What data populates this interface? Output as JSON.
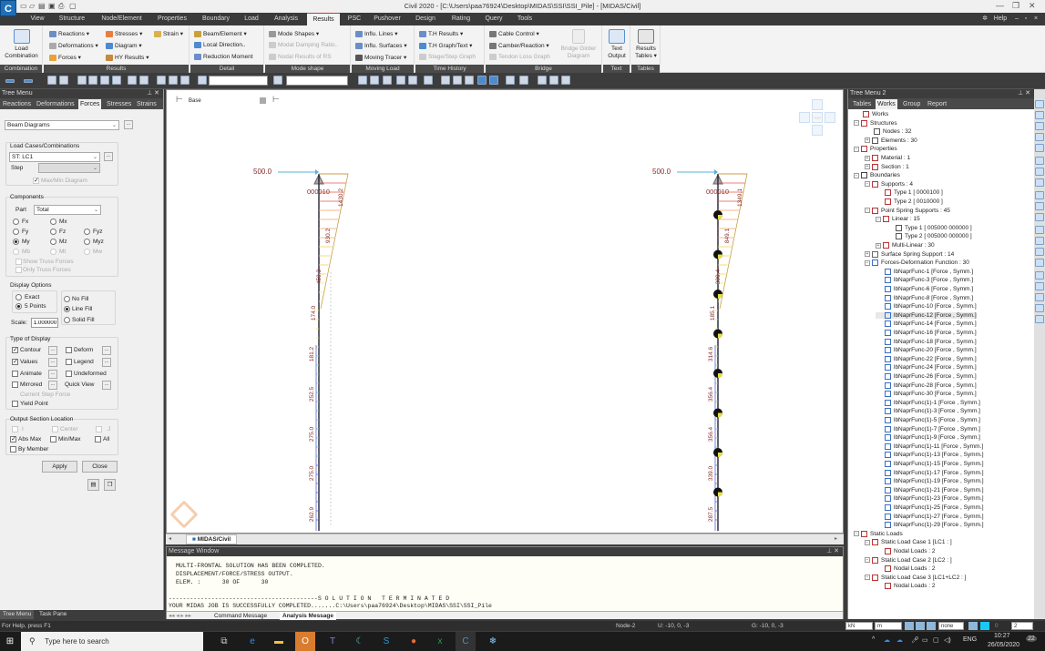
{
  "window": {
    "title": "Civil 2020 - [C:\\Users\\paa76924\\Desktop\\MIDAS\\SSI\\SSI_Pile] - [MIDAS/Civil]",
    "app_icon_letter": "C",
    "help_label": "Help"
  },
  "menu": {
    "tabs": [
      "View",
      "Structure",
      "Node/Element",
      "Properties",
      "Boundary",
      "Load",
      "Analysis",
      "Results",
      "PSC",
      "Pushover",
      "Design",
      "Rating",
      "Query",
      "Tools"
    ],
    "active": "Results"
  },
  "ribbon": {
    "groups": [
      {
        "label": "Combination",
        "items": [
          "Load Combination"
        ]
      },
      {
        "label": "Results",
        "items": [
          "Reactions",
          "Deformations",
          "Forces",
          "Stresses",
          "Diagram",
          "HY Results",
          "Strain"
        ]
      },
      {
        "label": "Detail",
        "items": [
          "Beam/Element",
          "Local Direction..",
          "Reduction Moment"
        ]
      },
      {
        "label": "Mode shape",
        "items": [
          "Mode Shapes",
          "Modal Damping Ratio..",
          "Nodal Results of RS"
        ]
      },
      {
        "label": "Moving Load",
        "items": [
          "Influ. Lines",
          "Influ. Surfaces",
          "Moving Tracer"
        ]
      },
      {
        "label": "Time History",
        "items": [
          "T.H Results",
          "T.H Graph/Text",
          "Stage/Step Graph"
        ]
      },
      {
        "label": "Bridge",
        "items": [
          "Cable Control",
          "Camber/Reaction",
          "Tendon Loss Graph",
          "Bridge Girder Diagram"
        ]
      },
      {
        "label": "Text",
        "items": [
          "Text Output"
        ]
      },
      {
        "label": "Tables",
        "items": [
          "Results Tables"
        ]
      }
    ]
  },
  "tree_menu": {
    "title": "Tree Menu",
    "tabs": [
      "Reactions",
      "Deformations",
      "Forces",
      "Stresses",
      "Strains"
    ],
    "active_tab": "Forces",
    "diagram_type": "Beam Diagrams",
    "load_cases_label": "Load Cases/Combinations",
    "load_case": "ST: LC1",
    "step_label": "Step",
    "step_value": "",
    "maxmin_label": "Max/Min Diagram",
    "components_label": "Components",
    "part_label": "Part",
    "part_value": "Total",
    "components": [
      "Fx",
      "Mx",
      "Fy",
      "Fz",
      "Fyz",
      "My",
      "Mz",
      "Myz",
      "Mb",
      "Mt",
      "Mw"
    ],
    "selected_component": "My",
    "show_truss": "Show Truss Forces",
    "only_truss": "Only Truss Forces",
    "display_options_label": "Display Options",
    "exact_label": "Exact",
    "five_points_label": "5 Points",
    "no_fill_label": "No Fill",
    "line_fill_label": "Line Fill",
    "solid_fill_label": "Solid Fill",
    "scale_label": "Scale:",
    "scale_value": "1.000000",
    "type_of_display_label": "Type of Display",
    "contour_label": "Contour",
    "deform_label": "Deform",
    "values_label": "Values",
    "legend_label": "Legend",
    "animate_label": "Animate",
    "undeformed_label": "Undeformed",
    "mirrored_label": "Mirrored",
    "quick_view_label": "Quick View",
    "current_step_force_label": "Current Step Force",
    "yield_point_label": "Yield Point",
    "output_section_label": "Output Section Location",
    "i_label": "I",
    "center_label": "Center",
    "j_label": "J",
    "abs_max_label": "Abs Max",
    "min_max_label": "Min/Max",
    "all_label": "All",
    "by_member_label": "By Member",
    "apply_label": "Apply",
    "close_label": "Close",
    "bottom_tabs": [
      "Tree Menu",
      "Task Pane"
    ]
  },
  "viewport": {
    "view_label": "Base",
    "tab_label": "MIDAS/Civil",
    "left_model": {
      "load_label": "500.0",
      "support_label": "000010",
      "values": [
        "1430.2",
        "930.2",
        "459.3",
        "174.0",
        "181.2",
        "252.5",
        "275.0",
        "275.0",
        "262.9"
      ]
    },
    "right_model": {
      "load_label": "500.0",
      "support_label": "000010",
      "values": [
        "1349.1",
        "849.1",
        "399.4",
        "185.1",
        "314.6",
        "356.4",
        "356.4",
        "339.0",
        "287.5"
      ]
    }
  },
  "message_window": {
    "title": "Message Window",
    "lines": [
      "MULTI-FRONTAL SOLUTION HAS BEEN COMPLETED.",
      "DISPLACEMENT/FORCE/STRESS OUTPUT.",
      "ELEM. :      30 OF      30",
      "",
      "------------------------------------------S O L U T I O N   T E R M I N A T E D",
      "YOUR MIDAS JOB IS SUCCESSFULLY COMPLETED.......C:\\Users\\paa76924\\Desktop\\MIDAS\\SSI\\SSI_Pile"
    ],
    "tabs": [
      "Command Message",
      "Analysis Message"
    ],
    "active_tab": "Analysis Message"
  },
  "tree_menu2": {
    "title": "Tree Menu 2",
    "tabs": [
      "Tables",
      "Works",
      "Group",
      "Report"
    ],
    "active_tab": "Works",
    "items": [
      {
        "level": 0,
        "text": "Works",
        "exp": ""
      },
      {
        "level": 0,
        "text": "Structures",
        "exp": "-"
      },
      {
        "level": 1,
        "text": "Nodes : 32",
        "exp": ""
      },
      {
        "level": 1,
        "text": "Elements : 30",
        "exp": "+"
      },
      {
        "level": 0,
        "text": "Properties",
        "exp": "-"
      },
      {
        "level": 1,
        "text": "Material : 1",
        "exp": "+"
      },
      {
        "level": 1,
        "text": "Section : 1",
        "exp": "+"
      },
      {
        "level": 0,
        "text": "Boundaries",
        "exp": "-"
      },
      {
        "level": 1,
        "text": "Supports : 4",
        "exp": "-"
      },
      {
        "level": 2,
        "text": "Type 1 [ 0000100 ]",
        "exp": ""
      },
      {
        "level": 2,
        "text": "Type 2 [ 0010000 ]",
        "exp": ""
      },
      {
        "level": 1,
        "text": "Point Spring Supports : 45",
        "exp": "-"
      },
      {
        "level": 2,
        "text": "Linear : 15",
        "exp": "-"
      },
      {
        "level": 3,
        "text": "Type 1 [ 005000 000000 ]",
        "exp": ""
      },
      {
        "level": 3,
        "text": "Type 2 [ 005000 000000 ]",
        "exp": ""
      },
      {
        "level": 2,
        "text": "Multi-Linear : 30",
        "exp": "+"
      },
      {
        "level": 1,
        "text": "Surface Spring Support : 14",
        "exp": "+"
      },
      {
        "level": 1,
        "text": "Forces-Deformation Function : 30",
        "exp": "-"
      },
      {
        "level": 2,
        "text": "lbNaprFunc-1 [Force , Symm.]",
        "exp": ""
      },
      {
        "level": 2,
        "text": "lbNaprFunc-3 [Force , Symm.]",
        "exp": ""
      },
      {
        "level": 2,
        "text": "lbNaprFunc-6 [Force , Symm.]",
        "exp": ""
      },
      {
        "level": 2,
        "text": "lbNaprFunc-8 [Force , Symm.]",
        "exp": ""
      },
      {
        "level": 2,
        "text": "lbNaprFunc-10 [Force , Symm.]",
        "exp": ""
      },
      {
        "level": 2,
        "text": "lbNaprFunc-12 [Force , Symm.]",
        "exp": "",
        "selected": true
      },
      {
        "level": 2,
        "text": "lbNaprFunc-14 [Force , Symm.]",
        "exp": ""
      },
      {
        "level": 2,
        "text": "lbNaprFunc-16 [Force , Symm.]",
        "exp": ""
      },
      {
        "level": 2,
        "text": "lbNaprFunc-18 [Force , Symm.]",
        "exp": ""
      },
      {
        "level": 2,
        "text": "lbNaprFunc-20 [Force , Symm.]",
        "exp": ""
      },
      {
        "level": 2,
        "text": "lbNaprFunc-22 [Force , Symm.]",
        "exp": ""
      },
      {
        "level": 2,
        "text": "lbNaprFunc-24 [Force , Symm.]",
        "exp": ""
      },
      {
        "level": 2,
        "text": "lbNaprFunc-26 [Force , Symm.]",
        "exp": ""
      },
      {
        "level": 2,
        "text": "lbNaprFunc-28 [Force , Symm.]",
        "exp": ""
      },
      {
        "level": 2,
        "text": "lbNaprFunc-30 [Force , Symm.]",
        "exp": ""
      },
      {
        "level": 2,
        "text": "lbNaprFunc(1)-1 [Force , Symm.]",
        "exp": ""
      },
      {
        "level": 2,
        "text": "lbNaprFunc(1)-3 [Force , Symm.]",
        "exp": ""
      },
      {
        "level": 2,
        "text": "lbNaprFunc(1)-5 [Force , Symm.]",
        "exp": ""
      },
      {
        "level": 2,
        "text": "lbNaprFunc(1)-7 [Force , Symm.]",
        "exp": ""
      },
      {
        "level": 2,
        "text": "lbNaprFunc(1)-9 [Force , Symm.]",
        "exp": ""
      },
      {
        "level": 2,
        "text": "lbNaprFunc(1)-11 [Force , Symm.]",
        "exp": ""
      },
      {
        "level": 2,
        "text": "lbNaprFunc(1)-13 [Force , Symm.]",
        "exp": ""
      },
      {
        "level": 2,
        "text": "lbNaprFunc(1)-15 [Force , Symm.]",
        "exp": ""
      },
      {
        "level": 2,
        "text": "lbNaprFunc(1)-17 [Force , Symm.]",
        "exp": ""
      },
      {
        "level": 2,
        "text": "lbNaprFunc(1)-19 [Force , Symm.]",
        "exp": ""
      },
      {
        "level": 2,
        "text": "lbNaprFunc(1)-21 [Force , Symm.]",
        "exp": ""
      },
      {
        "level": 2,
        "text": "lbNaprFunc(1)-23 [Force , Symm.]",
        "exp": ""
      },
      {
        "level": 2,
        "text": "lbNaprFunc(1)-25 [Force , Symm.]",
        "exp": ""
      },
      {
        "level": 2,
        "text": "lbNaprFunc(1)-27 [Force , Symm.]",
        "exp": ""
      },
      {
        "level": 2,
        "text": "lbNaprFunc(1)-29 [Force , Symm.]",
        "exp": ""
      },
      {
        "level": 0,
        "text": "Static Loads",
        "exp": "-"
      },
      {
        "level": 1,
        "text": "Static Load Case 1 [LC1 : ]",
        "exp": "-"
      },
      {
        "level": 2,
        "text": "Nodal Loads : 2",
        "exp": ""
      },
      {
        "level": 1,
        "text": "Static Load Case 2 [LC2 : ]",
        "exp": "-"
      },
      {
        "level": 2,
        "text": "Nodal Loads : 2",
        "exp": ""
      },
      {
        "level": 1,
        "text": "Static Load Case 3 [LC1+LC2 : ]",
        "exp": "-"
      },
      {
        "level": 2,
        "text": "Nodal Loads : 2",
        "exp": ""
      }
    ]
  },
  "statusbar": {
    "help": "For Help, press F1",
    "node": "Node-2",
    "ucs": "U: -10, 0, -3",
    "gcs": "G: -10, 0, -3",
    "force_unit": "kN",
    "length_unit": "m",
    "filter": "none",
    "counter": "0",
    "page": "2"
  },
  "taskbar": {
    "search_placeholder": "Type here to search",
    "language": "ENG",
    "time": "10:27",
    "date": "26/05/2020",
    "notifications": "22"
  },
  "colors": {
    "accent": "#c33333",
    "ribbon_bg": "#f3f3f3",
    "dark_bar": "#3c3c3c"
  }
}
